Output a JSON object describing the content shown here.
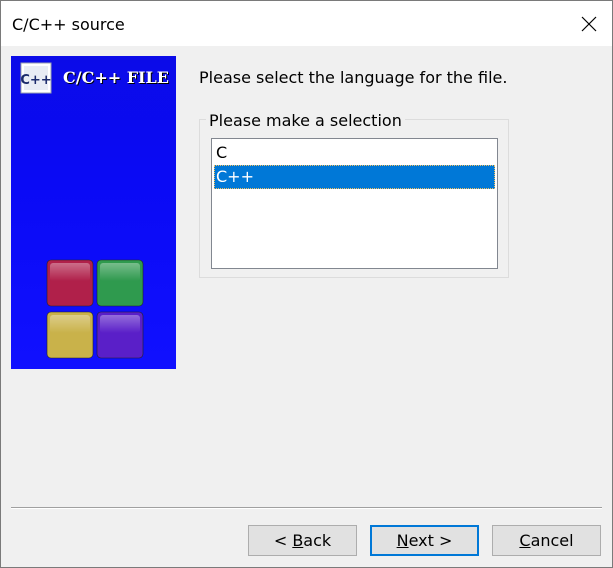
{
  "window": {
    "title": "C/C++ source"
  },
  "banner": {
    "logo_text": "C++",
    "title": "C/C++ FILE",
    "cube_colors": [
      "#b0204a",
      "#2f9a4e",
      "#c9b24a",
      "#5a1fc8"
    ]
  },
  "main": {
    "prompt": "Please select the language for the file.",
    "group_label": "Please make a selection",
    "options": [
      {
        "label": "C",
        "selected": false
      },
      {
        "label": "C++",
        "selected": true
      }
    ]
  },
  "buttons": {
    "back": {
      "prefix": "< ",
      "mnemonic": "B",
      "rest": "ack"
    },
    "next": {
      "prefix": "",
      "mnemonic": "N",
      "rest": "ext >"
    },
    "cancel": {
      "prefix": "",
      "mnemonic": "C",
      "rest": "ancel"
    }
  },
  "colors": {
    "selection": "#0078d7",
    "banner_blue": "#0a0af5",
    "default_button_border": "#0078d7"
  }
}
